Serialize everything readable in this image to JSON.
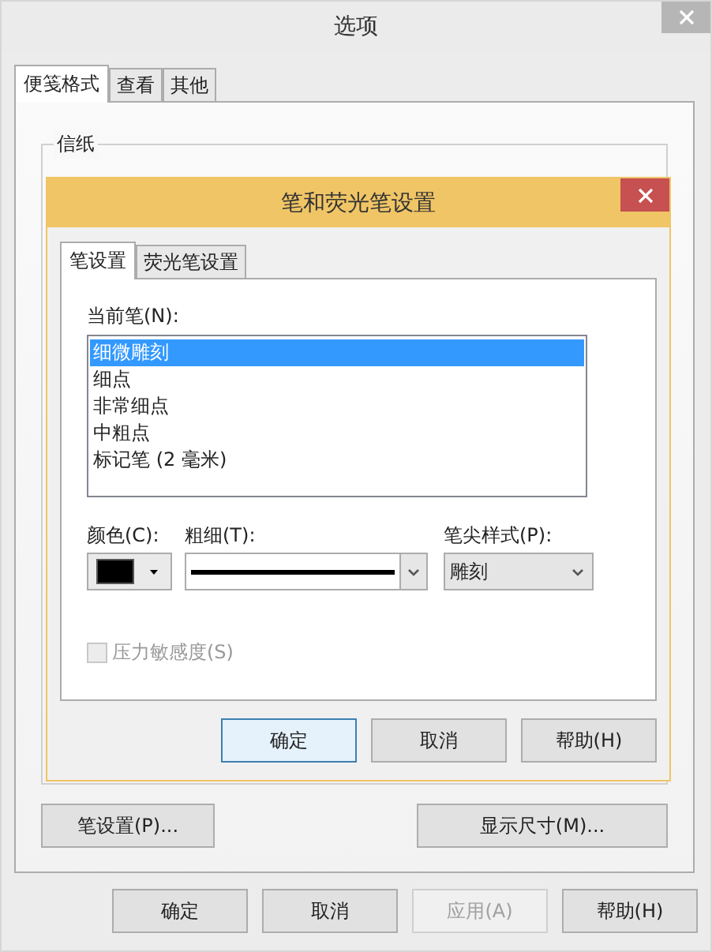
{
  "window": {
    "title": "选项"
  },
  "tabs": [
    {
      "label": "便笺格式",
      "selected": true
    },
    {
      "label": "查看",
      "selected": false
    },
    {
      "label": "其他",
      "selected": false
    }
  ],
  "group": {
    "title": "信纸"
  },
  "panel_buttons": [
    {
      "label": "笔设置(P)..."
    },
    {
      "label": "显示尺寸(M)..."
    }
  ],
  "buttons": [
    {
      "label": "确定",
      "disabled": false
    },
    {
      "label": "取消",
      "disabled": false
    },
    {
      "label": "应用(A)",
      "disabled": true
    },
    {
      "label": "帮助(H)",
      "disabled": false
    }
  ],
  "pen_dialog": {
    "title": "笔和荧光笔设置",
    "tabs": [
      {
        "label": "笔设置",
        "selected": true
      },
      {
        "label": "荧光笔设置",
        "selected": false
      }
    ],
    "current_pen_label": "当前笔(N):",
    "pens": [
      {
        "label": "细微雕刻",
        "selected": true
      },
      {
        "label": "细点",
        "selected": false
      },
      {
        "label": "非常细点",
        "selected": false
      },
      {
        "label": "中粗点",
        "selected": false
      },
      {
        "label": "标记笔 (2 毫米)",
        "selected": false
      }
    ],
    "color": {
      "label": "颜色(C):",
      "color": "#000000"
    },
    "thickness": {
      "label": "粗细(T):"
    },
    "tip_style": {
      "label": "笔尖样式(P):",
      "value": "雕刻"
    },
    "pressure": {
      "label": "压力敏感度(S)",
      "checked": false,
      "disabled": true
    },
    "buttons": [
      {
        "label": "确定",
        "default": true
      },
      {
        "label": "取消",
        "default": false
      },
      {
        "label": "帮助(H)",
        "default": false
      }
    ]
  }
}
